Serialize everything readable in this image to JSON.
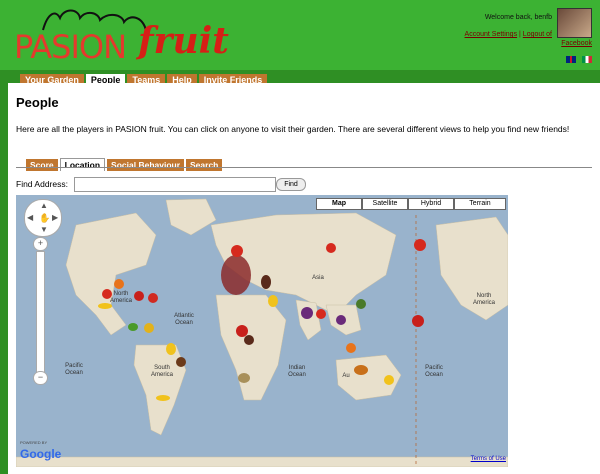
{
  "header": {
    "logo_part1": "PASION",
    "logo_part2": "fruit",
    "welcome": "Welcome back, benfb",
    "account_settings": "Account Settings",
    "logout": "Logout of",
    "facebook": "Facebook",
    "colors": {
      "header_bg": "#3cb233",
      "brand_red": "#e43a2d",
      "tab_orange": "#c0762f"
    }
  },
  "nav": {
    "tabs": [
      {
        "label": "Your Garden"
      },
      {
        "label": "People"
      },
      {
        "label": "Teams"
      },
      {
        "label": "Help"
      },
      {
        "label": "Invite Friends"
      }
    ]
  },
  "main": {
    "title": "People",
    "intro": "Here are all the players in PASION fruit. You can click on anyone to visit their garden. There are several different views to help you find new friends!",
    "sub_tabs": [
      {
        "label": "Score"
      },
      {
        "label": "Location"
      },
      {
        "label": "Social Behaviour"
      },
      {
        "label": "Search"
      }
    ],
    "find_label": "Find Address:",
    "find_value": "",
    "find_button": "Find"
  },
  "map": {
    "types": [
      {
        "label": "Map"
      },
      {
        "label": "Satellite"
      },
      {
        "label": "Hybrid"
      },
      {
        "label": "Terrain"
      }
    ],
    "labels": {
      "north_america_left": "North America",
      "atlantic": "Atlantic Ocean",
      "asia": "Asia",
      "pacific_left": "Pacific Ocean",
      "south_america": "South America",
      "indian": "Indian Ocean",
      "pacific_right": "Pacific Ocean",
      "north_america_right": "North America",
      "australia": "Au"
    },
    "powered_by": "POWERED BY",
    "google": "Google",
    "terms": "Terms of Use"
  }
}
